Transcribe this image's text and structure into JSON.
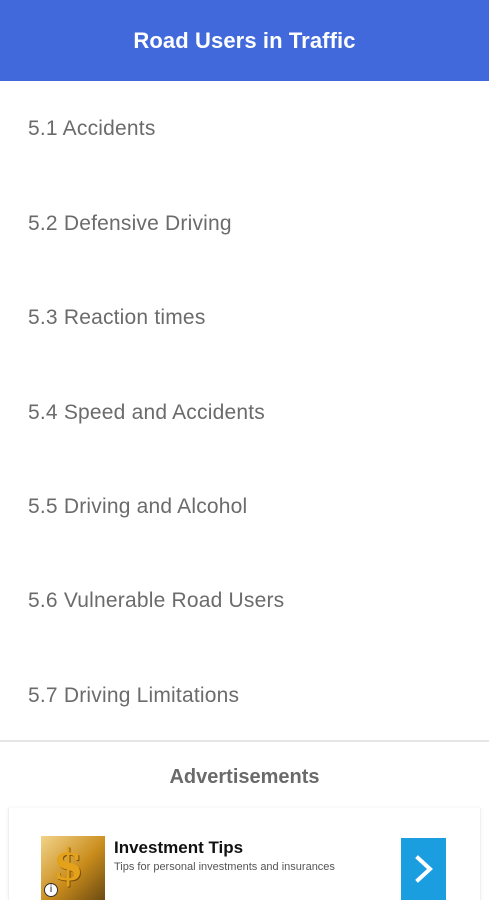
{
  "header": {
    "title": "Road Users in Traffic",
    "background": "#4169dc"
  },
  "list": {
    "items": [
      {
        "label": "5.1 Accidents"
      },
      {
        "label": "5.2 Defensive Driving"
      },
      {
        "label": "5.3 Reaction times"
      },
      {
        "label": "5.4 Speed and Accidents"
      },
      {
        "label": "5.5 Driving and Alcohol"
      },
      {
        "label": "5.6 Vulnerable Road Users"
      },
      {
        "label": "5.7 Driving Limitations"
      }
    ]
  },
  "ads": {
    "title": "Advertisements",
    "ad": {
      "headline": "Investment Tips",
      "subtitle": "Tips for personal investments and insurances",
      "thumb_icon": "dollar-icon",
      "info_icon": "info-icon",
      "cta_icon": "chevron-right-icon",
      "cta_color": "#1b9ee0"
    }
  }
}
